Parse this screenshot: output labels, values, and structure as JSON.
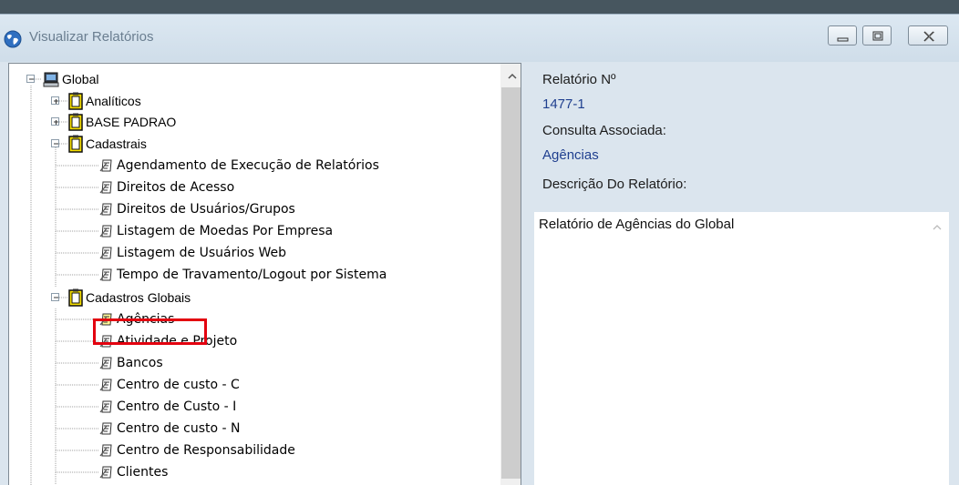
{
  "window": {
    "title": "Visualizar Relatórios",
    "icon": "globe-icon",
    "controls": [
      "minimize-icon",
      "maximize-icon",
      "close-icon"
    ]
  },
  "tree": {
    "root": "Global",
    "groups": [
      {
        "label": "Analíticos",
        "expanded": false
      },
      {
        "label": "BASE PADRAO",
        "expanded": false
      },
      {
        "label": "Cadastrais",
        "expanded": true,
        "items": [
          "Agendamento de Execução de Relatórios",
          "Direitos de Acesso",
          "Direitos de Usuários/Grupos",
          "Listagem de Moedas Por Empresa",
          "Listagem de Usuários Web",
          "Tempo de Travamento/Logout por Sistema"
        ]
      },
      {
        "label": "Cadastros Globais",
        "expanded": true,
        "items": [
          "Agências",
          "Atividade e Projeto",
          "Bancos",
          "Centro de custo - C",
          "Centro de Custo - I",
          "Centro de custo - N",
          "Centro de Responsabilidade",
          "Clientes"
        ]
      }
    ],
    "selected": "Agências"
  },
  "details": {
    "report_number_label": "Relatório Nº",
    "report_number": "1477-1",
    "query_label": "Consulta Associada:",
    "query_value": "Agências",
    "description_label": "Descrição Do Relatório:",
    "description": "Relatório de Agências do Global"
  },
  "colors": {
    "highlight": "#e3000f",
    "value_text": "#1f3f8f",
    "window_bg": "#dbe5ee"
  }
}
